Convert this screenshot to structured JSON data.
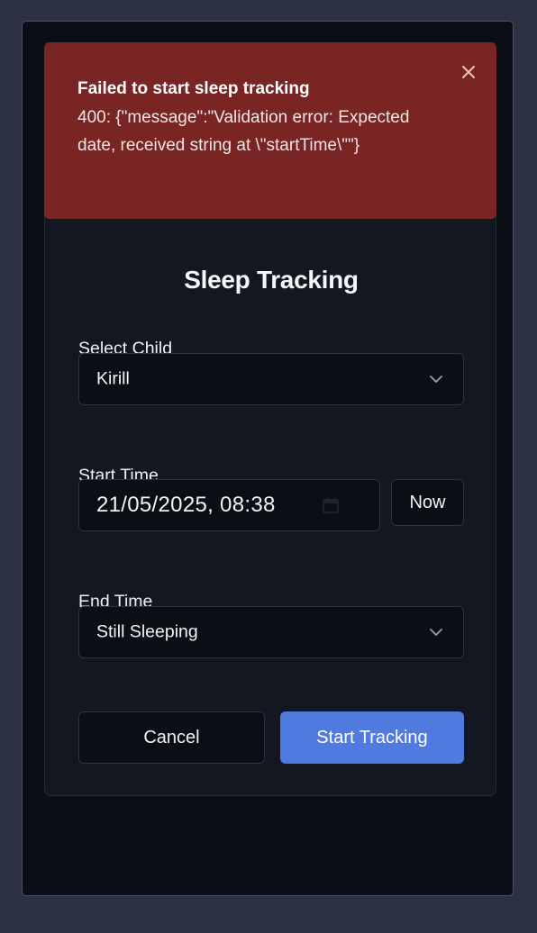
{
  "toast": {
    "title": "Failed to start sleep tracking",
    "message": "400: {\"message\":\"Validation error: Expected date, received string at \\\"startTime\\\"\"}",
    "close_icon": "close-icon",
    "color": "#782524"
  },
  "form": {
    "title": "Sleep Tracking",
    "child_label": "Select Child",
    "child_value": "Kirill",
    "start_label": "Start Time",
    "start_value": "21/05/2025, 08:38",
    "now_label": "Now",
    "end_label": "End Time",
    "end_value": "Still Sleeping",
    "cancel_label": "Cancel",
    "submit_label": "Start Tracking",
    "accent": "#4f7ae0"
  }
}
